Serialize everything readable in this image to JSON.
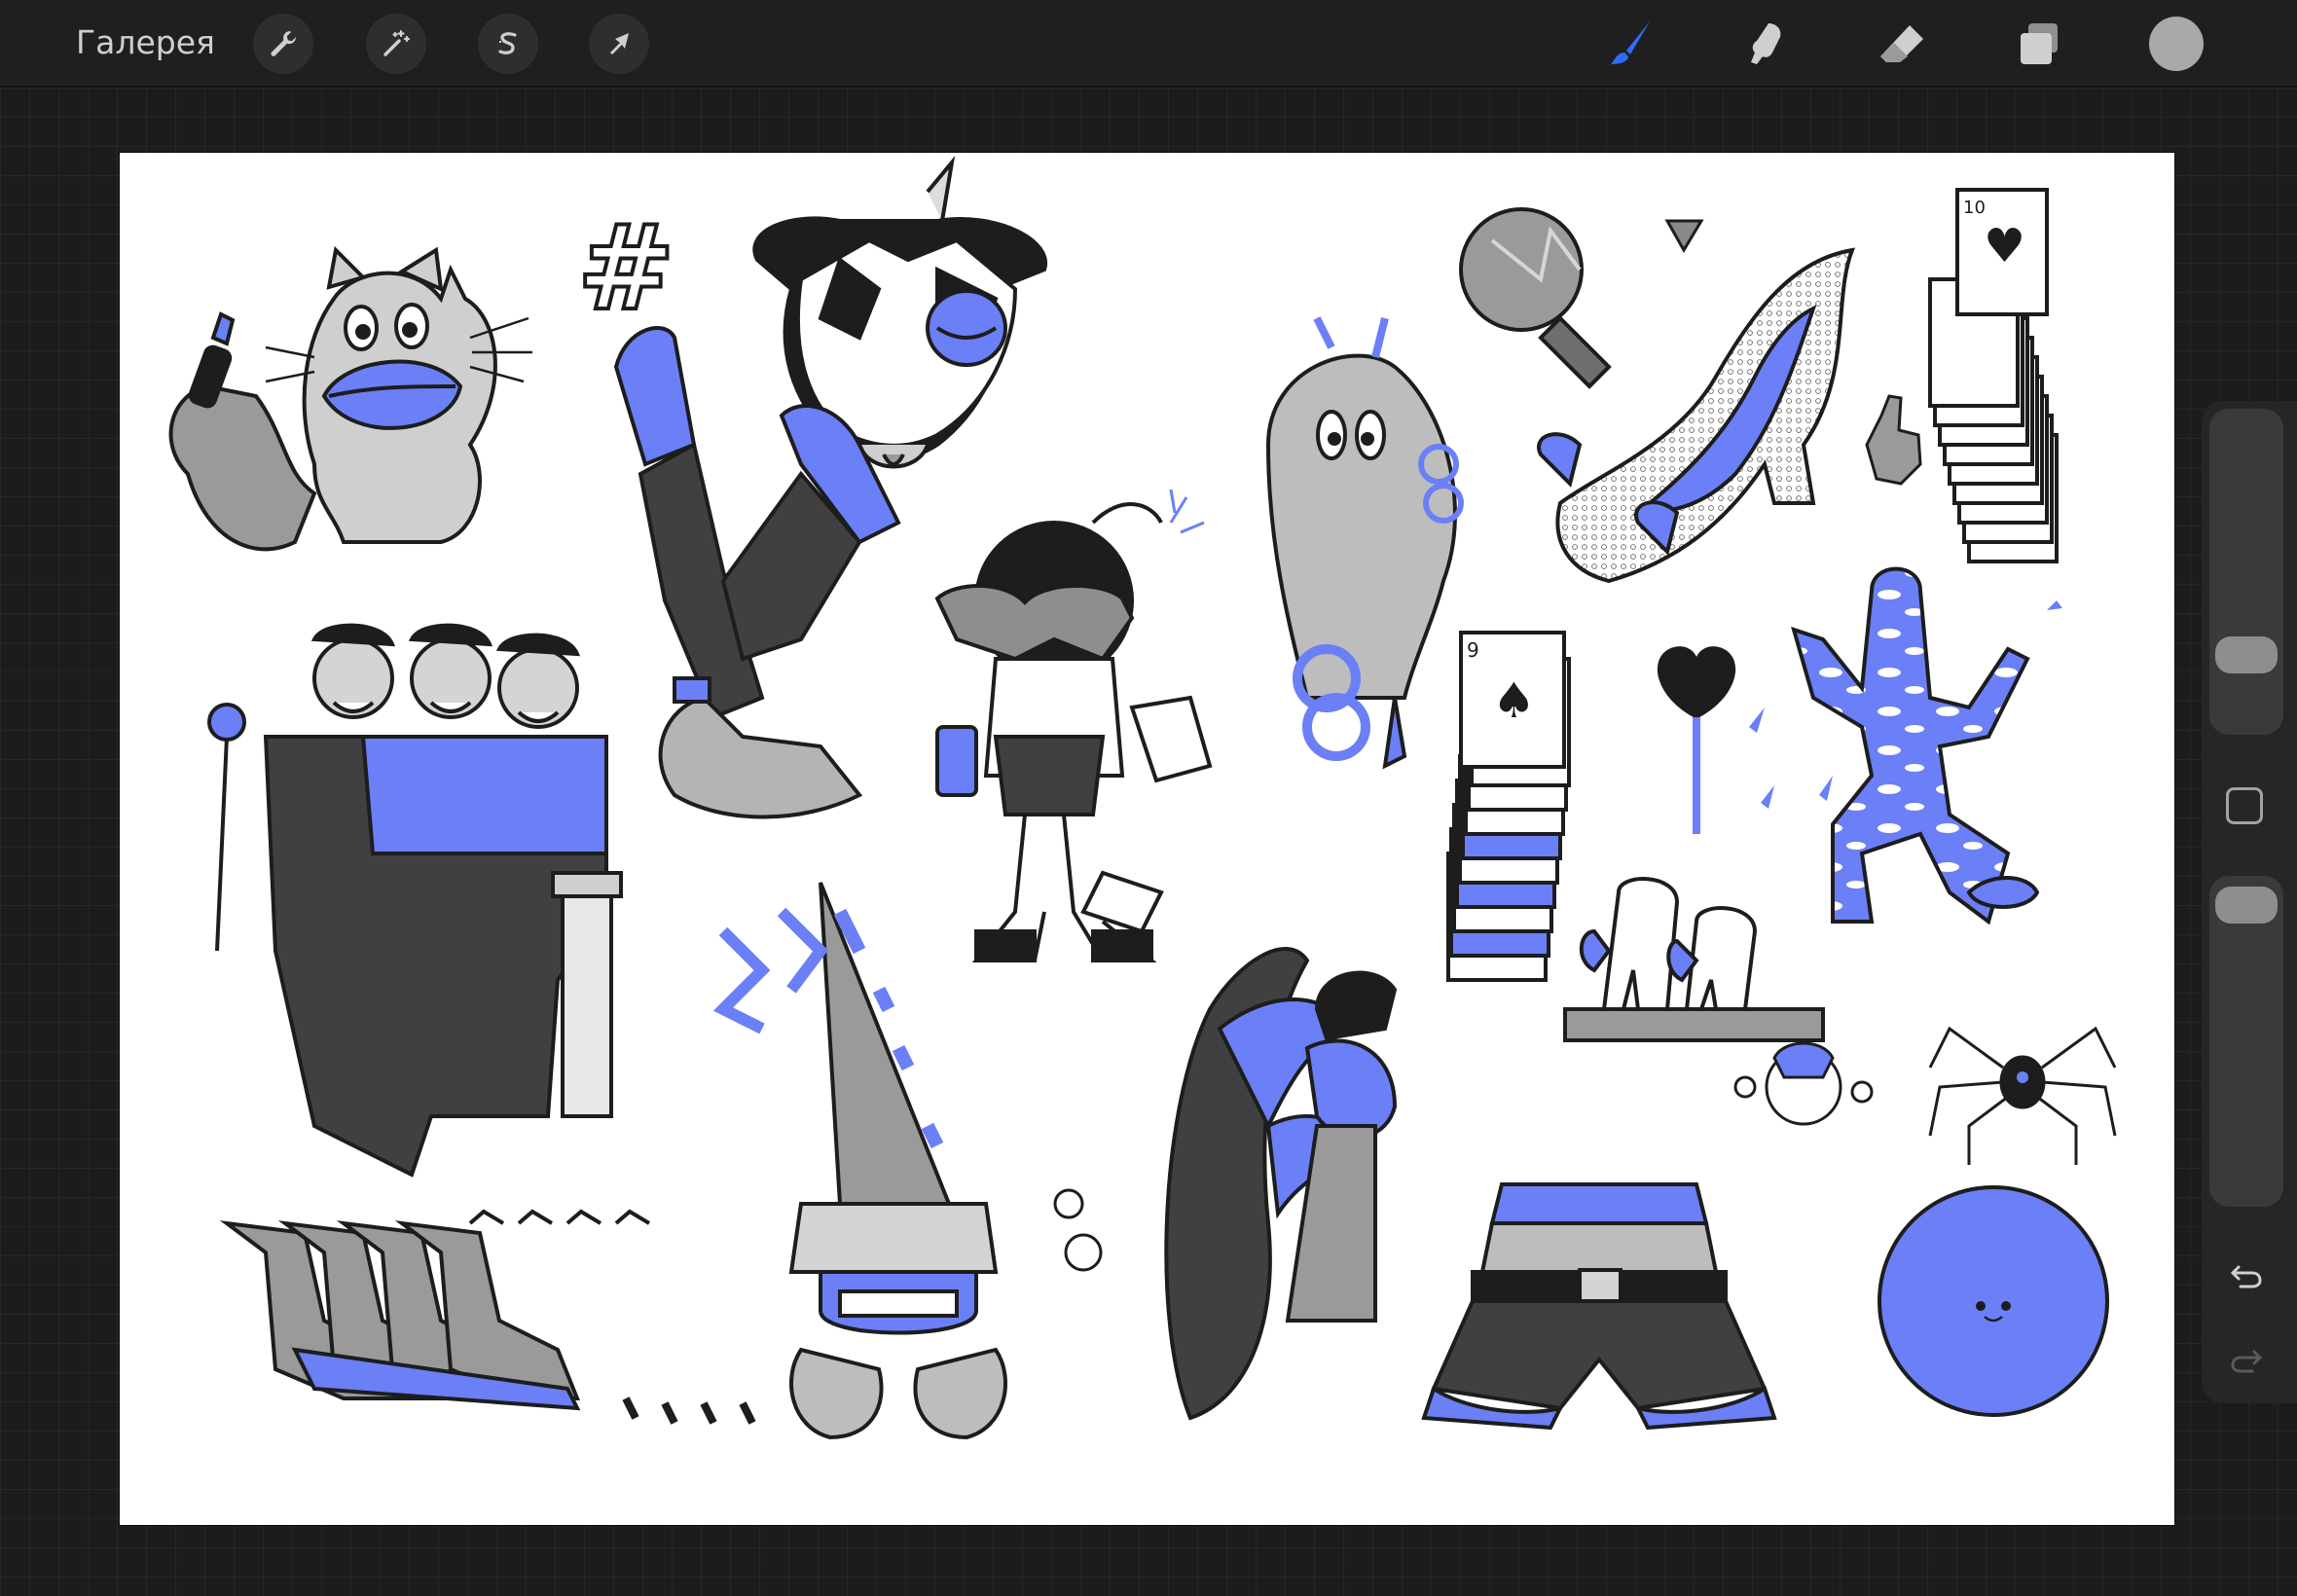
{
  "toolbar": {
    "gallery_label": "Галерея",
    "left_tools": [
      {
        "name": "wrench-icon",
        "action": "actions"
      },
      {
        "name": "magic-wand-icon",
        "action": "adjustments"
      },
      {
        "name": "selection-s-icon",
        "action": "selection"
      },
      {
        "name": "arrow-cursor-icon",
        "action": "transform"
      }
    ],
    "right_tools": [
      {
        "name": "brush-icon",
        "active": true
      },
      {
        "name": "smudge-icon",
        "active": false
      },
      {
        "name": "eraser-icon",
        "active": false
      },
      {
        "name": "layers-icon",
        "active": false
      },
      {
        "name": "color-swatch-icon",
        "active": false
      }
    ],
    "accent_color": "#2f6bff",
    "current_color": "#a9a9a9"
  },
  "canvas": {
    "background": "#ffffff",
    "palette": {
      "blue": "#6b7ff7",
      "dark": "#1d1d1d",
      "gray": "#9a9a9a",
      "light_gray": "#d4d4d4"
    },
    "cards_top": {
      "corner": "10",
      "suit": "♥"
    },
    "cards_middle": {
      "corner": "9",
      "suit": "♠"
    },
    "hash_symbol": "#"
  },
  "sidebar": {
    "brush_size_level": 0.35,
    "opacity_level": 0.95,
    "undo_icon": "undo-icon",
    "redo_icon": "redo-icon"
  }
}
